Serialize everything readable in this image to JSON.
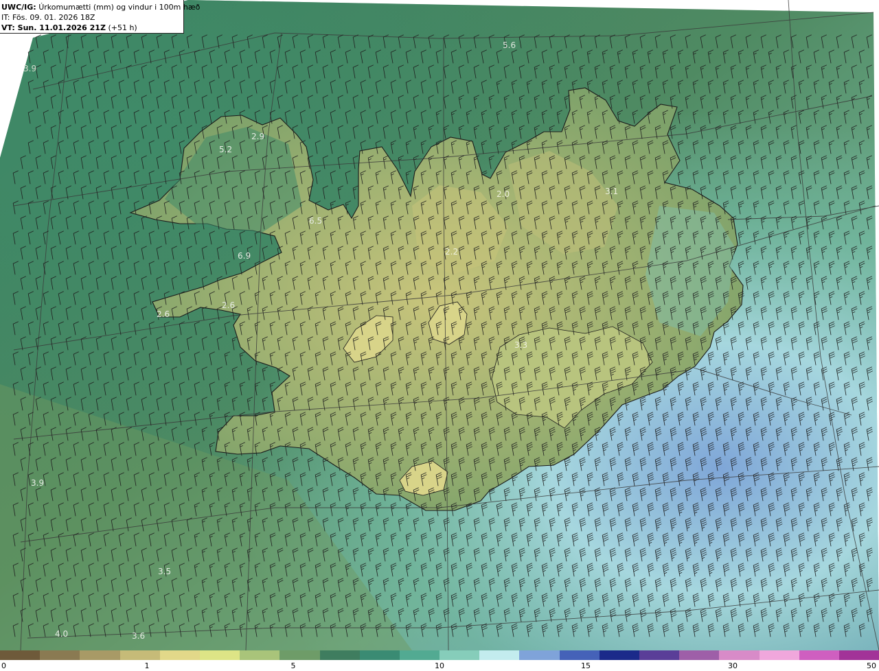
{
  "title": {
    "model": "UWC/IG:",
    "description": "Úrkomumætti (mm) og vindur i 100m hæð",
    "initial_time": "IT: Fös. 09. 01. 2026 18Z",
    "valid_label": "VT: Sun. 11.01.2026 21Z",
    "valid_offset": "(+51 h)"
  },
  "field_labels": [
    "3.9",
    "5.6",
    "5.2",
    "2.9",
    "6.5",
    "6.9",
    "2.6",
    "2.6",
    "2.2",
    "2.0",
    "3.1",
    "3.3",
    "3.9",
    "3.5",
    "4.0",
    "3.6"
  ],
  "colorbar": {
    "ticks": [
      "0",
      "1",
      "5",
      "10",
      "15",
      "30",
      "50"
    ],
    "colors": [
      "#6e5a3a",
      "#8a7a52",
      "#a89a66",
      "#c6bb78",
      "#e2d889",
      "#dde486",
      "#a9c47a",
      "#6e9c68",
      "#3f7d5f",
      "#3a8b73",
      "#52aa92",
      "#86cdba",
      "#c3ecee",
      "#7fa3d9",
      "#4562b8",
      "#1b2a8a",
      "#5a3e98",
      "#9e5fa8",
      "#d88bc8",
      "#f0a7dc",
      "#cf5fc0",
      "#a23398"
    ]
  },
  "colors": {
    "coastline": "#1a1a1a",
    "grid": "#3a3a3a",
    "barb": "#202020"
  }
}
